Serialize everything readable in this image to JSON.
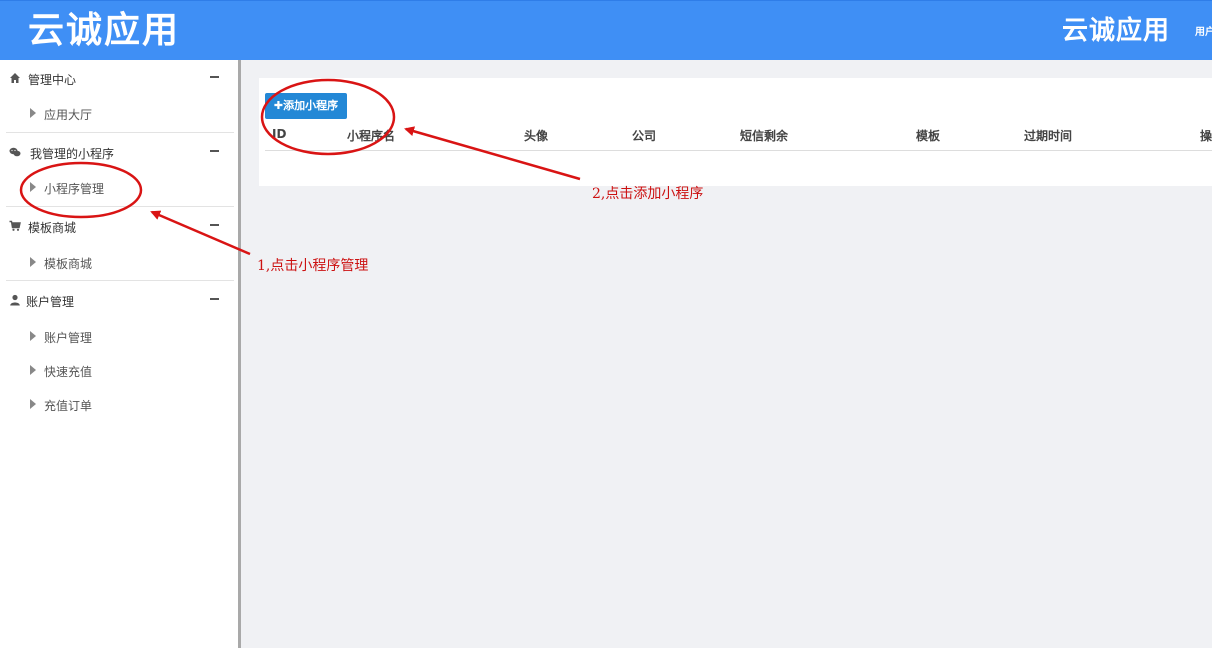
{
  "header": {
    "logo_left": "云诚应用",
    "logo_right": "云诚应用",
    "user_label": "用户"
  },
  "sidebar": {
    "groups": [
      {
        "label": "管理中心",
        "icon": "home-icon",
        "items": [
          "应用大厅"
        ]
      },
      {
        "label": "我管理的小程序",
        "icon": "wechat-icon",
        "items": [
          "小程序管理"
        ]
      },
      {
        "label": "模板商城",
        "icon": "cart-icon",
        "items": [
          "模板商城"
        ]
      },
      {
        "label": "账户管理",
        "icon": "user-icon",
        "items": [
          "账户管理",
          "快速充值",
          "充值订单"
        ]
      }
    ]
  },
  "main": {
    "add_button_label": "✚添加小程序",
    "table_headers": [
      "ID",
      "小程序名",
      "头像",
      "公司",
      "短信剩余",
      "模板",
      "过期时间",
      "操"
    ]
  },
  "annotations": {
    "step1": "1,点击小程序管理",
    "step2": "2,点击添加小程序",
    "color": "#d91414"
  },
  "colors": {
    "header_bg": "#3f8ff5",
    "button_bg": "#2388d6"
  }
}
